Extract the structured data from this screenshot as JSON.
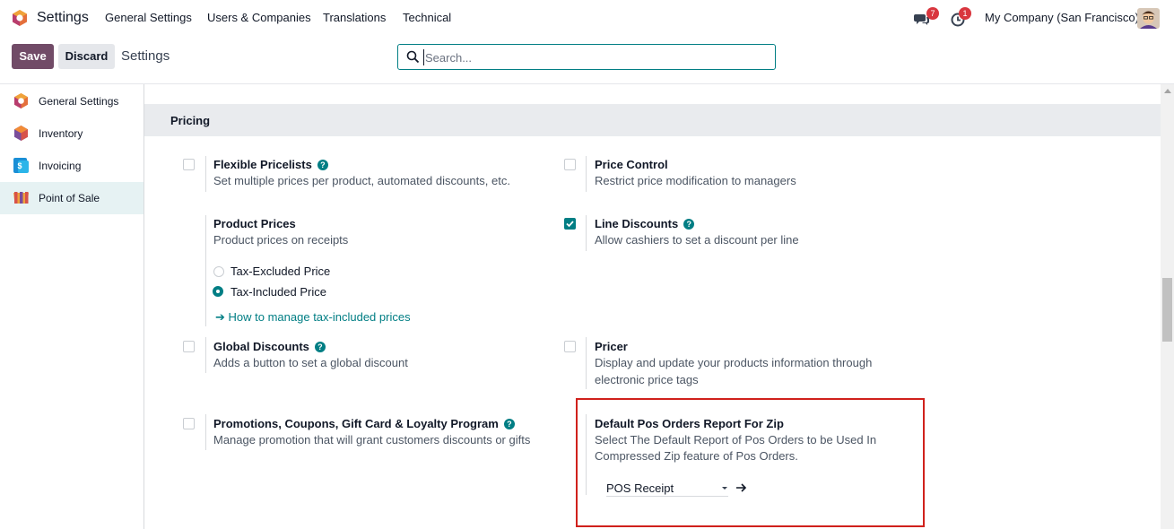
{
  "navbar": {
    "app_title": "Settings",
    "menu": [
      "General Settings",
      "Users & Companies",
      "Translations",
      "Technical"
    ],
    "messages_badge": "7",
    "activities_badge": "1",
    "company": "My Company (San Francisco)"
  },
  "control_panel": {
    "save_label": "Save",
    "discard_label": "Discard",
    "breadcrumb": "Settings",
    "search": {
      "value": "",
      "placeholder": "Search..."
    }
  },
  "sidebar": {
    "items": [
      {
        "label": "General Settings",
        "icon": "odoo-logo-icon",
        "active": false
      },
      {
        "label": "Inventory",
        "icon": "inventory-box-icon",
        "active": false
      },
      {
        "label": "Invoicing",
        "icon": "invoicing-icon",
        "active": false
      },
      {
        "label": "Point of Sale",
        "icon": "point-of-sale-shop-icon",
        "active": true
      }
    ]
  },
  "section": {
    "title": "Pricing",
    "settings": {
      "flexible_pricelists": {
        "title": "Flexible Pricelists",
        "desc": "Set multiple prices per product, automated discounts, etc.",
        "checked": false,
        "help": "?"
      },
      "price_control": {
        "title": "Price Control",
        "desc": "Restrict price modification to managers",
        "checked": false
      },
      "product_prices": {
        "title": "Product Prices",
        "desc": "Product prices on receipts",
        "options": [
          {
            "label": "Tax-Excluded Price",
            "selected": false
          },
          {
            "label": "Tax-Included Price",
            "selected": true
          }
        ],
        "link": "How to manage tax-included prices"
      },
      "line_discounts": {
        "title": "Line Discounts",
        "desc": "Allow cashiers to set a discount per line",
        "checked": true,
        "help": "?"
      },
      "global_discounts": {
        "title": "Global Discounts",
        "desc": "Adds a button to set a global discount",
        "checked": false,
        "help": "?"
      },
      "pricer": {
        "title": "Pricer",
        "desc_line1": "Display and update your products information through",
        "desc_line2": "electronic price tags",
        "checked": false
      },
      "promotions": {
        "title": "Promotions, Coupons, Gift Card & Loyalty Program",
        "desc": "Manage promotion that will grant customers discounts or gifts",
        "checked": false,
        "help": "?"
      },
      "default_pos_report": {
        "title": "Default Pos Orders Report For Zip",
        "desc_line1": "Select The Default Report of Pos Orders to be Used In",
        "desc_line2": "Compressed Zip feature of Pos Orders.",
        "selected": "POS Receipt"
      }
    }
  },
  "colors": {
    "brand": "#714b67",
    "accent": "#017e84",
    "highlight": "#d0211c",
    "badge": "#d9363e"
  }
}
